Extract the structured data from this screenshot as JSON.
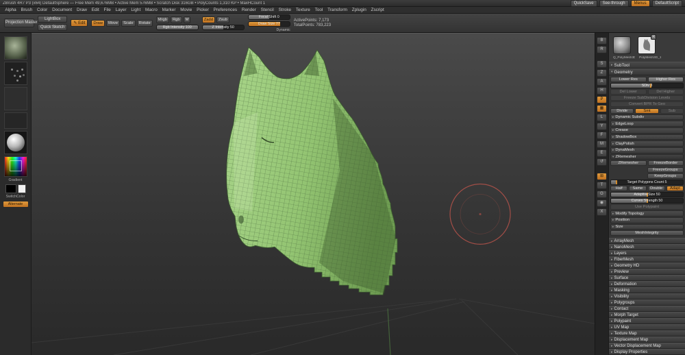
{
  "accent": "#d08a2c",
  "titlebar": {
    "title": "ZBrush 4R7 P3 (x64)   DefaultSphere — Free Mem 49,676MB • Active Mem 576MB • Scratch Disk 316GB • PolyCounts 1,310 KP • MaxHCount 1",
    "buttons": [
      {
        "label": "QuickSave",
        "accent": false
      },
      {
        "label": "See-through",
        "accent": false
      },
      {
        "label": "Menus",
        "accent": true
      },
      {
        "label": "DefaultScript",
        "accent": false
      }
    ]
  },
  "menubar": {
    "items": [
      "Alpha",
      "Brush",
      "Color",
      "Document",
      "Draw",
      "Edit",
      "File",
      "Layer",
      "Light",
      "Macro",
      "Marker",
      "Movie",
      "Picker",
      "Preferences",
      "Render",
      "Stencil",
      "Stroke",
      "Texture",
      "Tool",
      "Transform",
      "Zplugin",
      "Zscript"
    ]
  },
  "shelf": {
    "projection_master": "Projection Master",
    "lightbox": "LightBox",
    "quick_sketch": "Quick Sketch",
    "edit": "Edit",
    "draw": "Draw",
    "move": "Move",
    "scale": "Scale",
    "rotate": "Rotate",
    "mrgb": "Mrgb",
    "rgb": "Rgb",
    "m": "M",
    "zadd": "Zadd",
    "zsub": "Zsub",
    "rgb_intensity": "Rgb Intensity 100",
    "z_intensity": "Z Intensity 50",
    "focal_shift": "Focal Shift 0",
    "draw_size": "Draw Size 77",
    "dynamic": "Dynamic",
    "active_points": "ActivePoints: 7,173",
    "total_points": "TotalPoints: 783,223"
  },
  "tray": {
    "gradient_label": "Gradient",
    "switch_label": "SwitchColor",
    "alternate_label": "Alternate"
  },
  "rightshelf": {
    "buttons": [
      {
        "name": "bpr-render-button",
        "glyph": "B",
        "active": false
      },
      {
        "name": "render-button",
        "glyph": "R",
        "active": false
      },
      {
        "name": "scroll-button",
        "glyph": "S",
        "active": false
      },
      {
        "name": "zoom-button",
        "glyph": "Z",
        "active": false
      },
      {
        "name": "actual-button",
        "glyph": "A",
        "active": false
      },
      {
        "name": "aahalf-button",
        "glyph": "H",
        "active": false
      },
      {
        "name": "persp-button",
        "glyph": "P",
        "active": true
      },
      {
        "name": "floor-button",
        "glyph": "▦",
        "active": true
      },
      {
        "name": "local-button",
        "glyph": "L",
        "active": false
      },
      {
        "name": "lsym-button",
        "glyph": "Y",
        "active": false
      },
      {
        "name": "frame-button",
        "glyph": "F",
        "active": false
      },
      {
        "name": "move-button",
        "glyph": "M",
        "active": false
      },
      {
        "name": "scale-button",
        "glyph": "E",
        "active": false
      },
      {
        "name": "rotate-button",
        "glyph": "↺",
        "active": false
      },
      {
        "name": "polyframe-button",
        "glyph": "⊞",
        "active": true
      },
      {
        "name": "transp-button",
        "glyph": "T",
        "active": false
      },
      {
        "name": "ghost-button",
        "glyph": "G",
        "active": false
      },
      {
        "name": "solo-button",
        "glyph": "◉",
        "active": false
      },
      {
        "name": "xpose-button",
        "glyph": "X",
        "active": false
      }
    ]
  },
  "toolpanel": {
    "thumb1_label": "Q_PolyMesh3D_1",
    "thumb2_label": "PolyMesh3D_1",
    "thumb_badge": "R",
    "subtool_header": "SubTool",
    "geometry_header": "Geometry",
    "geo_rows": [
      {
        "t": "btns",
        "items": [
          {
            "l": "Lower Res"
          },
          {
            "l": "Higher Res",
            "s": "lit"
          }
        ]
      },
      {
        "t": "slider",
        "l": "SDiv 3",
        "f": 0.55
      },
      {
        "t": "btns",
        "items": [
          {
            "l": "Del Lower",
            "s": "dim"
          },
          {
            "l": "Del Higher",
            "s": "dim"
          }
        ]
      },
      {
        "t": "btn",
        "l": "Freeze SubDivision Levels",
        "s": "dim"
      },
      {
        "t": "btn",
        "l": "Convert BPR To Geo",
        "s": "dim"
      },
      {
        "t": "btns",
        "items": [
          {
            "l": "Divide"
          },
          {
            "l": "Smt",
            "s": "on"
          },
          {
            "l": "Sub",
            "s": "dim"
          }
        ]
      },
      {
        "t": "hdr",
        "l": "Dynamic Subdiv"
      },
      {
        "t": "hdr",
        "l": "EdgeLoop"
      },
      {
        "t": "hdr",
        "l": "Crease"
      },
      {
        "t": "hdr",
        "l": "ShadowBox"
      },
      {
        "t": "hdr",
        "l": "ClayPolish"
      },
      {
        "t": "hdr",
        "l": "DynaMesh"
      },
      {
        "t": "hdr",
        "l": "ZRemesher",
        "open": true
      },
      {
        "t": "btns",
        "items": [
          {
            "l": "ZRemesher"
          },
          {
            "l": "FreezeBorder"
          }
        ]
      },
      {
        "t": "rbtn",
        "l": "FreezeGroups"
      },
      {
        "t": "rbtn",
        "l": "KeepGroups"
      },
      {
        "t": "slider",
        "l": "Target Polygons Count 5",
        "f": 0.08
      },
      {
        "t": "btns",
        "items": [
          {
            "l": "Half"
          },
          {
            "l": "Same"
          },
          {
            "l": "Double"
          },
          {
            "l": "Adapt",
            "s": "on"
          }
        ]
      },
      {
        "t": "slider",
        "l": "AdaptiveSize 50",
        "f": 0.5
      },
      {
        "t": "slider",
        "l": "Curves Strength 50",
        "f": 0.5
      },
      {
        "t": "btn",
        "l": "Use Polypaint",
        "s": "dim"
      },
      {
        "t": "hdr",
        "l": "Modify Topology"
      },
      {
        "t": "hdr",
        "l": "Position"
      },
      {
        "t": "hdr",
        "l": "Size"
      },
      {
        "t": "btn",
        "l": "MeshIntegrity"
      }
    ],
    "sections": [
      "ArrayMesh",
      "NanoMesh",
      "Layers",
      "FiberMesh",
      "Geometry HD",
      "Preview",
      "Surface",
      "Deformation",
      "Masking",
      "Visibility",
      "Polygroups",
      "Contact",
      "Morph Target",
      "Polypaint",
      "UV Map",
      "Texture Map",
      "Displacement Map",
      "Vector Displacement Map",
      "Display Properties"
    ]
  },
  "icons": {
    "collapsed": "▸",
    "expanded": "▾",
    "pencil": "✎"
  },
  "canvas": {
    "cursor_color": "#b5524a",
    "model_color_light": "#a9d58a",
    "model_color_mid": "#93c472",
    "model_color_dark": "#6f9e52",
    "wire_color": "#44633a"
  }
}
